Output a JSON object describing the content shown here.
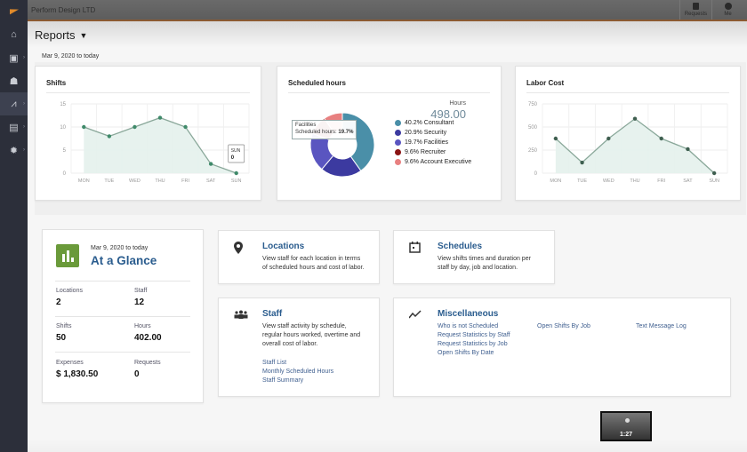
{
  "topbar": {
    "company": "Perform Design LTD",
    "requests_label": "Requests",
    "me_label": "Me"
  },
  "sidebar": {
    "items": [
      {
        "name": "home",
        "icon": "home-icon",
        "glyph": "⌂"
      },
      {
        "name": "schedule",
        "icon": "schedule-icon",
        "glyph": "▣"
      },
      {
        "name": "staff",
        "icon": "people-icon",
        "glyph": "☗"
      },
      {
        "name": "reports",
        "icon": "chart-icon",
        "glyph": "⩘",
        "active": true
      },
      {
        "name": "messages",
        "icon": "chat-icon",
        "glyph": "▤"
      },
      {
        "name": "settings",
        "icon": "gear-icon",
        "glyph": "✹"
      }
    ]
  },
  "page": {
    "title": "Reports",
    "date_range": "Mar 9, 2020 to today"
  },
  "chart_data": [
    {
      "type": "area",
      "title": "Shifts",
      "categories": [
        "MON",
        "TUE",
        "WED",
        "THU",
        "FRI",
        "SAT",
        "SUN"
      ],
      "values": [
        10,
        8,
        10,
        12,
        10,
        2,
        0
      ],
      "yticks": [
        "0",
        "5",
        "10",
        "15"
      ],
      "ylim": [
        0,
        15
      ],
      "grid": true,
      "color": "#3f8a6a",
      "tooltip": {
        "label": "SUN",
        "value": "0"
      }
    },
    {
      "type": "pie",
      "title": "Scheduled hours",
      "total_label": "Hours",
      "total_value": "498.00",
      "slices": [
        {
          "label": "Consultant",
          "percent": 40.2,
          "display": "40.2% Consultant",
          "color": "#4a8fa8"
        },
        {
          "label": "Security",
          "percent": 20.9,
          "display": "20.9% Security",
          "color": "#3c3aa0"
        },
        {
          "label": "Facilities",
          "percent": 19.7,
          "display": "19.7% Facilities",
          "color": "#5a55c0"
        },
        {
          "label": "Recruiter",
          "percent": 9.6,
          "display": "9.6% Recruiter",
          "color": "#8a1414"
        },
        {
          "label": "Account Executive",
          "percent": 9.6,
          "display": "9.6% Account Executive",
          "color": "#e88080"
        }
      ],
      "tooltip": {
        "title": "Facilities",
        "label": "Scheduled hours",
        "value": "19.7%"
      }
    },
    {
      "type": "area",
      "title": "Labor Cost",
      "categories": [
        "MON",
        "TUE",
        "WED",
        "THU",
        "FRI",
        "SAT",
        "SUN"
      ],
      "values": [
        375,
        115,
        375,
        590,
        375,
        260,
        0
      ],
      "yticks": [
        "0",
        "250",
        "500",
        "750"
      ],
      "ylim": [
        0,
        750
      ],
      "grid": true,
      "color": "#3f5f50"
    }
  ],
  "glance": {
    "date_range": "Mar 9, 2020 to today",
    "title": "At a Glance",
    "stats": [
      {
        "label": "Locations",
        "value": "2"
      },
      {
        "label": "Staff",
        "value": "12"
      },
      {
        "label": "Shifts",
        "value": "50"
      },
      {
        "label": "Hours",
        "value": "402.00"
      },
      {
        "label": "Expenses",
        "value": "$ 1,830.50"
      },
      {
        "label": "Requests",
        "value": "0"
      }
    ]
  },
  "cards": {
    "locations": {
      "title": "Locations",
      "desc1": "View staff for each location in terms",
      "desc2": "of scheduled hours and cost of labor."
    },
    "schedules": {
      "title": "Schedules",
      "desc1": "View shifts times and duration per",
      "desc2": "staff by day, job and location."
    },
    "staff": {
      "title": "Staff",
      "desc1": "View staff activity by schedule,",
      "desc2": "regular hours worked, overtime and",
      "desc3": "overall cost of labor.",
      "links": [
        "Staff List",
        "Monthly Scheduled Hours",
        "Staff Summary"
      ]
    },
    "misc": {
      "title": "Miscellaneous",
      "col1": [
        "Who is not Scheduled",
        "Request Statistics by Staff",
        "Request Statistics by Job",
        "Open Shifts By Date"
      ],
      "col2": [
        "Open Shifts By Job"
      ],
      "col3": [
        "Text Message Log"
      ]
    }
  },
  "video": {
    "time": "1:27"
  }
}
